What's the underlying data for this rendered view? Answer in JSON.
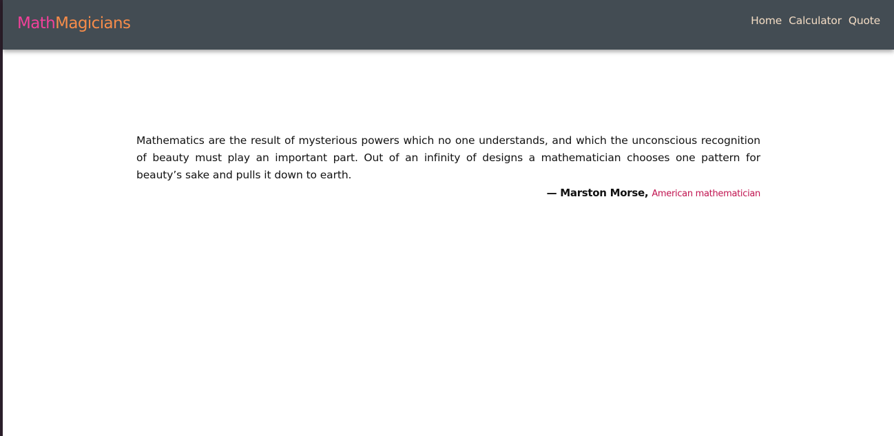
{
  "app": {
    "brand_part1": "Math",
    "brand_part2": "Magicians",
    "colors": {
      "navbar_bg": "#434c53",
      "brand_part1": "#f2419a",
      "brand_part2": "#f68c4a",
      "nav_link": "#f3dcc4",
      "author_title": "#c0124f"
    }
  },
  "nav": {
    "items": [
      {
        "label": "Home"
      },
      {
        "label": "Calculator"
      },
      {
        "label": "Quote"
      }
    ]
  },
  "quote": {
    "text": "Mathematics are the result of mysterious powers which no one understands, and which the unconscious recognition of beauty must play an important part. Out of an infinity of designs a mathematician chooses one pattern for beauty’s sake and pulls it down to earth.",
    "author": "— Marston Morse,",
    "author_title": "American mathematician"
  }
}
